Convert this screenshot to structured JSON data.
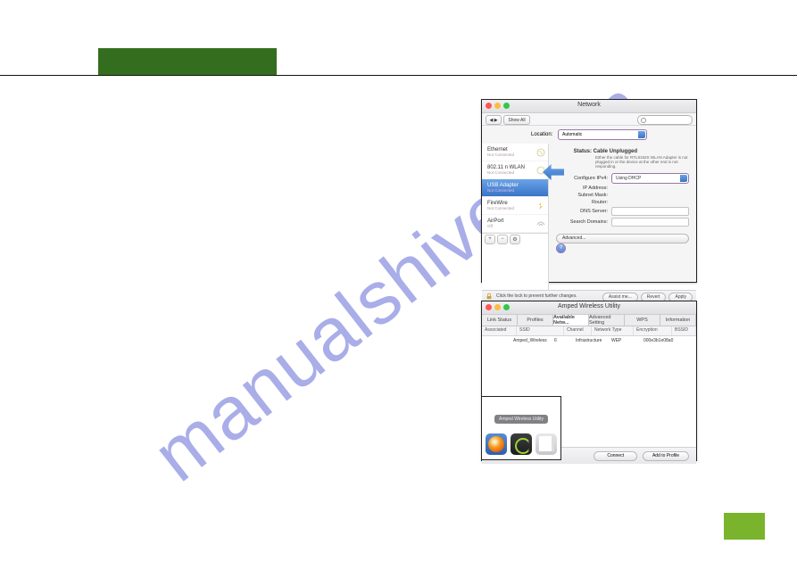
{
  "watermark": "manualshive.com",
  "network_window": {
    "title": "Network",
    "toolbar": {
      "show_all": "Show All",
      "search_placeholder": ""
    },
    "location_label": "Location:",
    "location_value": "Automatic",
    "sidebar": [
      {
        "name": "Ethernet",
        "sub": "Not Connected"
      },
      {
        "name": "802.11 n WLAN",
        "sub": "Not Connected"
      },
      {
        "name": "USB Adapter",
        "sub": "Not Connected"
      },
      {
        "name": "FireWire",
        "sub": "Not Connected"
      },
      {
        "name": "AirPort",
        "sub": "Off"
      }
    ],
    "selected_index": 2,
    "status_label": "Status:",
    "status_value": "Cable Unplugged",
    "status_desc": "Either the cable for RTL8192S WLAN Adapter is not plugged in or the device at the other end is not responding.",
    "configure_label": "Configure IPv4:",
    "configure_value": "Using DHCP",
    "fields": {
      "ip": "IP Address:",
      "mask": "Subnet Mask:",
      "router": "Router:",
      "dns": "DNS Server:",
      "search": "Search Domains:"
    },
    "advanced": "Advanced...",
    "footer_lock_text": "Click the lock to prevent further changes.",
    "assist": "Assist me...",
    "revert": "Revert",
    "apply": "Apply",
    "plus": "+",
    "minus": "−",
    "gear": "⚙︎"
  },
  "wireless_window": {
    "title": "Amped Wireless Utility",
    "tabs": [
      "Link Status",
      "Profiles",
      "Available Netw...",
      "Advanced Setting",
      "WPS",
      "Information"
    ],
    "selected_tab": 2,
    "headers": [
      "Associated",
      "SSID",
      "Channel",
      "Network Type",
      "Encryption",
      "BSSID"
    ],
    "rows": [
      {
        "associated": "",
        "ssid": "Amped_Wireless",
        "channel": "6",
        "type": "Infrastructure",
        "encryption": "WEP",
        "bssid": "000e3b1e08a0"
      }
    ],
    "connect": "Connect",
    "add_to_profile": "Add to Profile"
  },
  "dock": {
    "tooltip": "Amped Wireless Utility"
  }
}
